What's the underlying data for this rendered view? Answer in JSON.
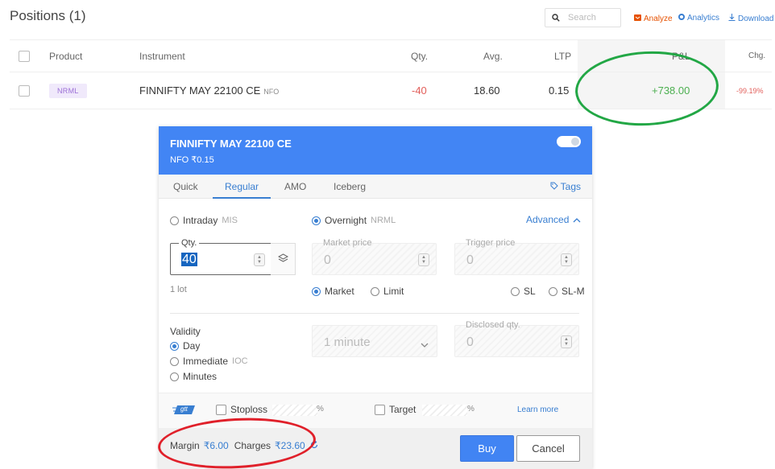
{
  "header": {
    "title": "Positions (1)",
    "search_placeholder": "Search",
    "analyze": "Analyze",
    "analytics": "Analytics",
    "download": "Download"
  },
  "table": {
    "columns": [
      "Product",
      "Instrument",
      "Qty.",
      "Avg.",
      "LTP",
      "P&L",
      "Chg."
    ],
    "row": {
      "product": "NRML",
      "instrument": "FINNIFTY MAY 22100 CE",
      "exchange": "NFO",
      "qty": "-40",
      "avg": "18.60",
      "ltp": "0.15",
      "pnl": "+738.00",
      "chg": "-99.19%"
    }
  },
  "order": {
    "title": "FINNIFTY MAY 22100 CE",
    "subtitle": "NFO ₹0.15",
    "tabs": [
      "Quick",
      "Regular",
      "AMO",
      "Iceberg"
    ],
    "active_tab": "Regular",
    "tags": "Tags",
    "intraday": "Intraday",
    "intraday_code": "MIS",
    "overnight": "Overnight",
    "overnight_code": "NRML",
    "advanced": "Advanced",
    "qty_label": "Qty.",
    "qty_value": "40",
    "lot": "1 lot",
    "market_price_label": "Market price",
    "market_price_value": "0",
    "trigger_price_label": "Trigger price",
    "trigger_price_value": "0",
    "order_types": [
      "Market",
      "Limit",
      "SL",
      "SL-M"
    ],
    "validity_label": "Validity",
    "validity_options": [
      "Day",
      "Immediate",
      "Minutes"
    ],
    "ioc": "IOC",
    "minutes_value": "1 minute",
    "disclosed_label": "Disclosed qty.",
    "disclosed_value": "0",
    "gtt": "gtt",
    "stoploss": "Stoploss",
    "target": "Target",
    "percent": "%",
    "learn_more": "Learn more",
    "margin_label": "Margin",
    "margin_value": "₹6.00",
    "charges_label": "Charges",
    "charges_value": "₹23.60",
    "buy": "Buy",
    "cancel": "Cancel"
  },
  "colors": {
    "accent": "#4285f4",
    "negative": "#e25f5b",
    "positive": "#4caf50",
    "annotation_green": "#22a745",
    "annotation_red": "#e0202a"
  }
}
